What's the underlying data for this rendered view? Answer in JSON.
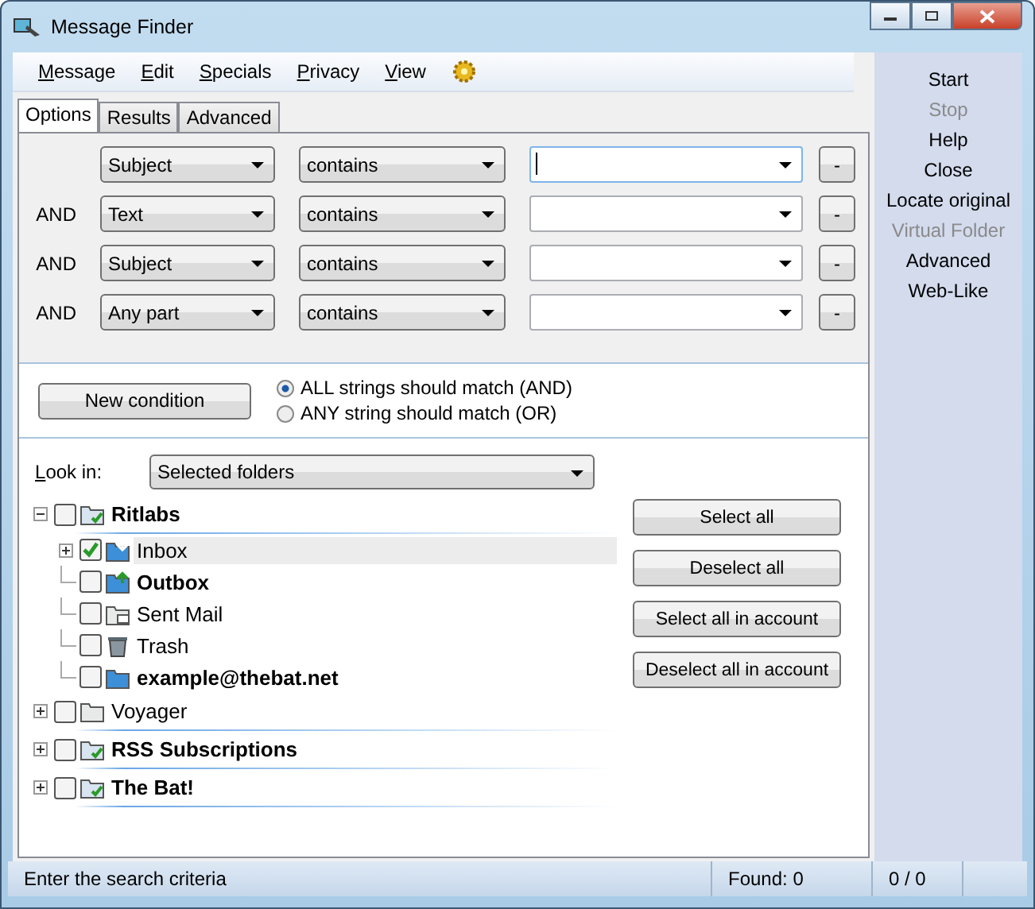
{
  "window": {
    "title": "Message Finder"
  },
  "menu": [
    {
      "label": "Message"
    },
    {
      "label": "Edit"
    },
    {
      "label": "Specials"
    },
    {
      "label": "Privacy"
    },
    {
      "label": "View"
    }
  ],
  "tabs": [
    {
      "label": "Options",
      "selected": true
    },
    {
      "label": "Results",
      "selected": false
    },
    {
      "label": "Advanced",
      "selected": false
    }
  ],
  "conditions": [
    {
      "field": "Subject",
      "operator": "contains",
      "focused": true
    },
    {
      "connective": "AND",
      "field": "Text",
      "operator": "contains",
      "focused": false
    },
    {
      "connective": "AND",
      "field": "Subject",
      "operator": "contains",
      "focused": false
    },
    {
      "connective": "AND",
      "field": "Any part",
      "operator": "contains",
      "focused": false
    }
  ],
  "remove_label": "-",
  "new_condition": "New condition",
  "match_options": [
    {
      "label": "ALL strings should match (AND)",
      "selected": true
    },
    {
      "label": "ANY string should match (OR)",
      "selected": false
    }
  ],
  "look_in": {
    "label": "Look in:",
    "value": "Selected folders"
  },
  "tree": [
    {
      "name": "Ritlabs",
      "kind": "account",
      "bold": true,
      "checked": false,
      "selected": false,
      "expanded": true,
      "children": [
        {
          "name": "Inbox",
          "kind": "inbox",
          "bold": false,
          "checked": true,
          "selected": true,
          "expanded": false
        },
        {
          "name": "Outbox",
          "kind": "outbox",
          "bold": true,
          "checked": false,
          "selected": false
        },
        {
          "name": "Sent Mail",
          "kind": "sent",
          "bold": false,
          "checked": false,
          "selected": false
        },
        {
          "name": "Trash",
          "kind": "trash",
          "bold": false,
          "checked": false,
          "selected": false
        },
        {
          "name": "example@thebat.net",
          "kind": "folder",
          "bold": true,
          "checked": false,
          "selected": false
        }
      ]
    },
    {
      "name": "Voyager",
      "kind": "plain",
      "bold": false,
      "checked": false,
      "selected": false,
      "expanded": false
    },
    {
      "name": "RSS Subscriptions",
      "kind": "account",
      "bold": true,
      "checked": false,
      "selected": false,
      "expanded": false
    },
    {
      "name": "The Bat!",
      "kind": "account",
      "bold": true,
      "checked": false,
      "selected": false,
      "expanded": false
    }
  ],
  "tree_buttons": [
    "Select all",
    "Deselect all",
    "Select all in account",
    "Deselect all in account"
  ],
  "sidebar": {
    "items": [
      {
        "label": "Start",
        "disabled": false
      },
      {
        "label": "Stop",
        "disabled": true
      },
      {
        "label": "Help",
        "disabled": false
      },
      {
        "label": "Close",
        "disabled": false
      },
      {
        "label": "Locate original",
        "disabled": false
      },
      {
        "label": "Virtual Folder",
        "disabled": true
      },
      {
        "label": "Advanced",
        "disabled": false
      },
      {
        "label": "Web-Like",
        "disabled": false
      }
    ]
  },
  "status_bar": {
    "message": "Enter the search criteria",
    "found": "Found: 0",
    "count": "0 / 0"
  }
}
